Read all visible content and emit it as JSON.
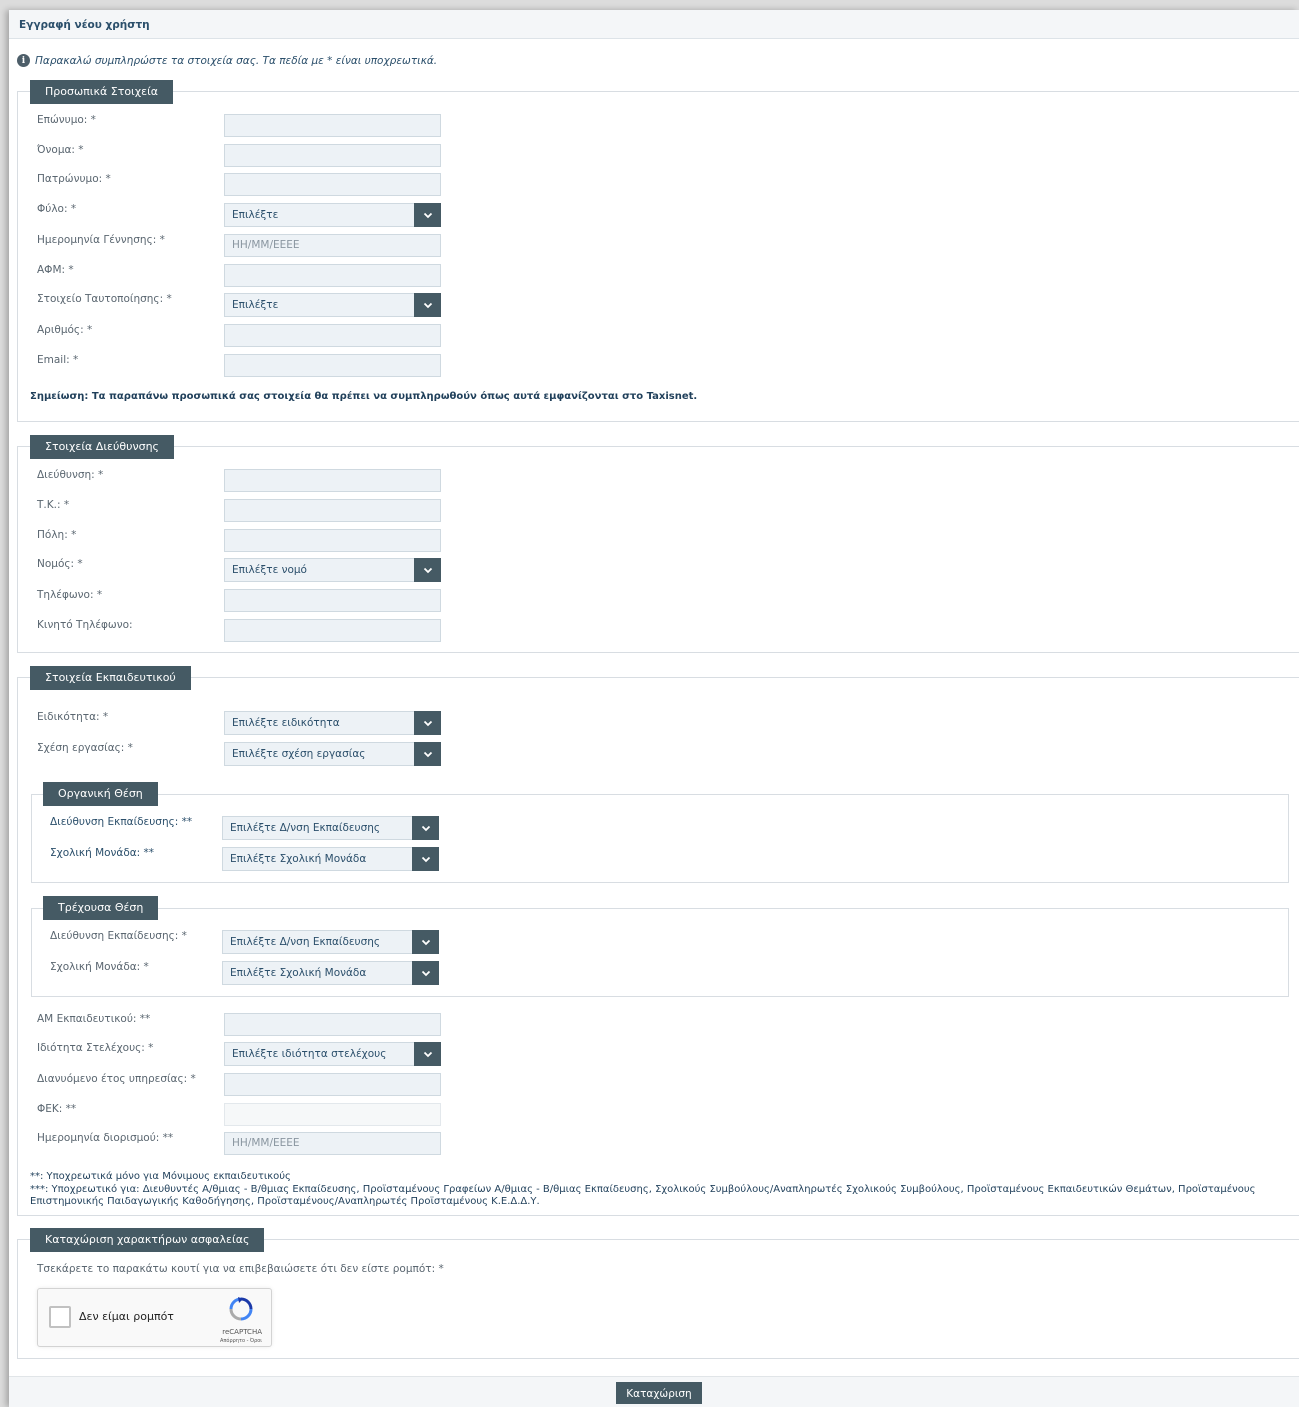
{
  "page": {
    "title": "Εγγραφή νέου χρήστη",
    "info": "Παρακαλώ συμπληρώστε τα στοιχεία σας. Τα πεδία με * είναι υποχρεωτικά."
  },
  "personal": {
    "legend": "Προσωπικά Στοιχεία",
    "surname": "Επώνυμο:  *",
    "name": "Όνομα:  *",
    "fathername": "Πατρώνυμο:  *",
    "gender": "Φύλο:  *",
    "gender_value": "Επιλέξτε",
    "birthdate": "Ημερομηνία Γέννησης:  *",
    "birthdate_placeholder": "ΗΗ/ΜΜ/ΕΕΕΕ",
    "afm": "ΑΦΜ:  *",
    "idtype": "Στοιχείο Ταυτοποίησης:  *",
    "idtype_value": "Επιλέξτε",
    "idnumber": "Αριθμός:  *",
    "email": "Email:  *",
    "note": "Σημείωση: Τα παραπάνω προσωπικά σας στοιχεία θα πρέπει να συμπληρωθούν όπως αυτά εμφανίζονται στο Taxisnet."
  },
  "address": {
    "legend": "Στοιχεία Διεύθυνσης",
    "street": "Διεύθυνση:  *",
    "zip": "Τ.Κ.:  *",
    "city": "Πόλη:  *",
    "prefecture": "Νομός:  *",
    "prefecture_value": "Επιλέξτε νομό",
    "phone": "Τηλέφωνο:  *",
    "mobile": "Κινητό Τηλέφωνο:"
  },
  "educator": {
    "legend": "Στοιχεία Εκπαιδευτικού",
    "specialty": "Ειδικότητα:  *",
    "specialty_value": "Επιλέξτε ειδικότητα",
    "relation": "Σχέση εργασίας:  *",
    "relation_value": "Επιλέξτε σχέση εργασίας",
    "organic": {
      "legend": "Οργανική Θέση",
      "direction": "Διεύθυνση Εκπαίδευσης: **",
      "direction_value": "Επιλέξτε Δ/νση Εκπαίδευσης",
      "school": "Σχολική Μονάδα: **",
      "school_value": "Επιλέξτε Σχολική Μονάδα"
    },
    "current": {
      "legend": "Τρέχουσα Θέση",
      "direction": "Διεύθυνση Εκπαίδευσης:  *",
      "direction_value": "Επιλέξτε Δ/νση Εκπαίδευσης",
      "school": "Σχολική Μονάδα:  *",
      "school_value": "Επιλέξτε Σχολική Μονάδα"
    },
    "am": "ΑΜ Εκπαιδευτικού: **",
    "staff": "Ιδιότητα Στελέχους:  *",
    "staff_value": "Επιλέξτε ιδιότητα στελέχους",
    "service_year": "Διανυόμενο έτος υπηρεσίας:  *",
    "fek": "ΦΕΚ: **",
    "appointment": "Ημερομηνία διορισμού: **",
    "appointment_placeholder": "ΗΗ/ΜΜ/ΕΕΕΕ",
    "note1": "**: Υποχρεωτικά μόνο για Μόνιμους εκπαιδευτικούς",
    "note2": "***: Υποχρεωτικό για: Διευθυντές Α/θμιας - Β/θμιας Εκπαίδευσης, Προϊσταμένους Γραφείων Α/θμιας - Β/θμιας Εκπαίδευσης, Σχολικούς Συμβούλους/Αναπληρωτές Σχολικούς Συμβούλους, Προϊσταμένους Εκπαιδευτικών Θεμάτων, Προϊσταμένους",
    "note3": "Επιστημονικής Παιδαγωγικής Καθοδήγησης, Προϊσταμένους/Αναπληρωτές Προϊσταμένους Κ.Ε.Δ.Δ.Υ."
  },
  "security": {
    "legend": "Καταχώριση χαρακτήρων ασφαλείας",
    "prompt": "Τσεκάρετε το παρακάτω κουτί για να επιβεβαιώσετε ότι δεν είστε ρομπότ:  *",
    "captcha_label": "Δεν είμαι ρομπότ",
    "captcha_brand": "reCAPTCHA",
    "captcha_terms": "Απόρρητο - Όροι"
  },
  "submit_label": "Καταχώριση",
  "colors": {
    "accent": "#455a64",
    "input_bg": "#edf2f6",
    "title": "#2b4f6b"
  },
  "icons": [
    "info-icon",
    "chevron-down-icon",
    "recaptcha-logo-icon"
  ]
}
